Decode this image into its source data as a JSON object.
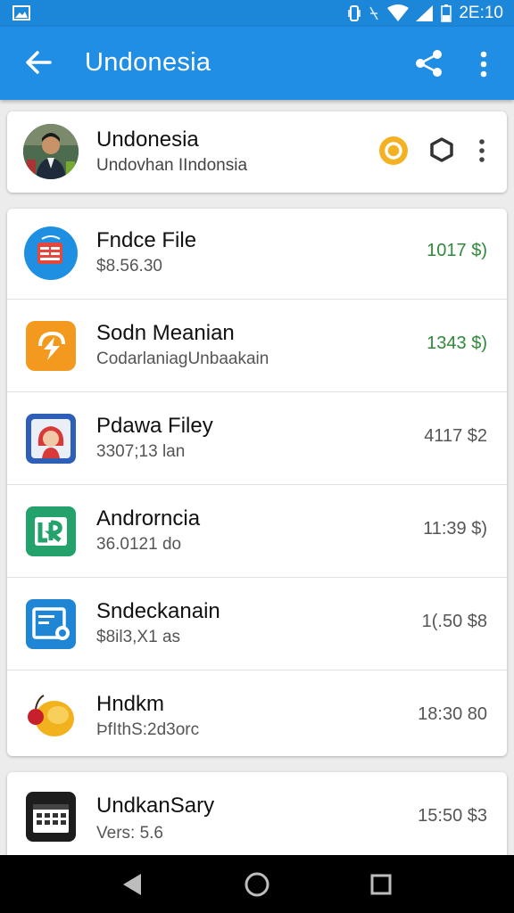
{
  "status_bar": {
    "time": "2E:10"
  },
  "app_bar": {
    "title": "Undonesia"
  },
  "header": {
    "title": "Undonesia",
    "subtitle": "Undovhan IIndonsia"
  },
  "items": [
    {
      "name": "Fndce File",
      "sub": "$8.56.30",
      "price": "1017 $)",
      "price_color": "#2f8a3a"
    },
    {
      "name": "Sodn Meanian",
      "sub": "CodarlaniagUnbaakain",
      "price": "1343 $)",
      "price_color": "#2f8a3a"
    },
    {
      "name": "Pdawa Filey",
      "sub": "3307;13 lan",
      "price": "4117 $2",
      "price_color": "#555555"
    },
    {
      "name": "Androrncia",
      "sub": "36.0121 do",
      "price": "11:39 $)",
      "price_color": "#555555"
    },
    {
      "name": "Sndeckanain",
      "sub": "$8il3,X1 as",
      "price": "1(.50 $8",
      "price_color": "#555555"
    },
    {
      "name": "Hndkm",
      "sub": "ÞfIthS:2d3orc",
      "price": "18:30 80",
      "price_color": "#555555"
    }
  ],
  "bottom_item": {
    "name": "UndkanSary",
    "sub": "Vers: 5.6",
    "price": "15:50 $3"
  },
  "icons": {
    "status_left": "image-icon",
    "status_right": [
      "vibrate-icon",
      "nfc-icon",
      "wifi-icon",
      "signal-icon",
      "battery-icon"
    ],
    "app_bar": [
      "back-arrow-icon",
      "share-icon",
      "more-vert-icon"
    ],
    "header": [
      "coin-icon",
      "hexagon-icon",
      "more-vert-icon"
    ],
    "nav": [
      "nav-back-icon",
      "nav-home-icon",
      "nav-recents-icon"
    ]
  },
  "colors": {
    "app_bar": "#1f8ee4",
    "status_bar": "#1c86d8",
    "green_price": "#2f8a3a"
  }
}
